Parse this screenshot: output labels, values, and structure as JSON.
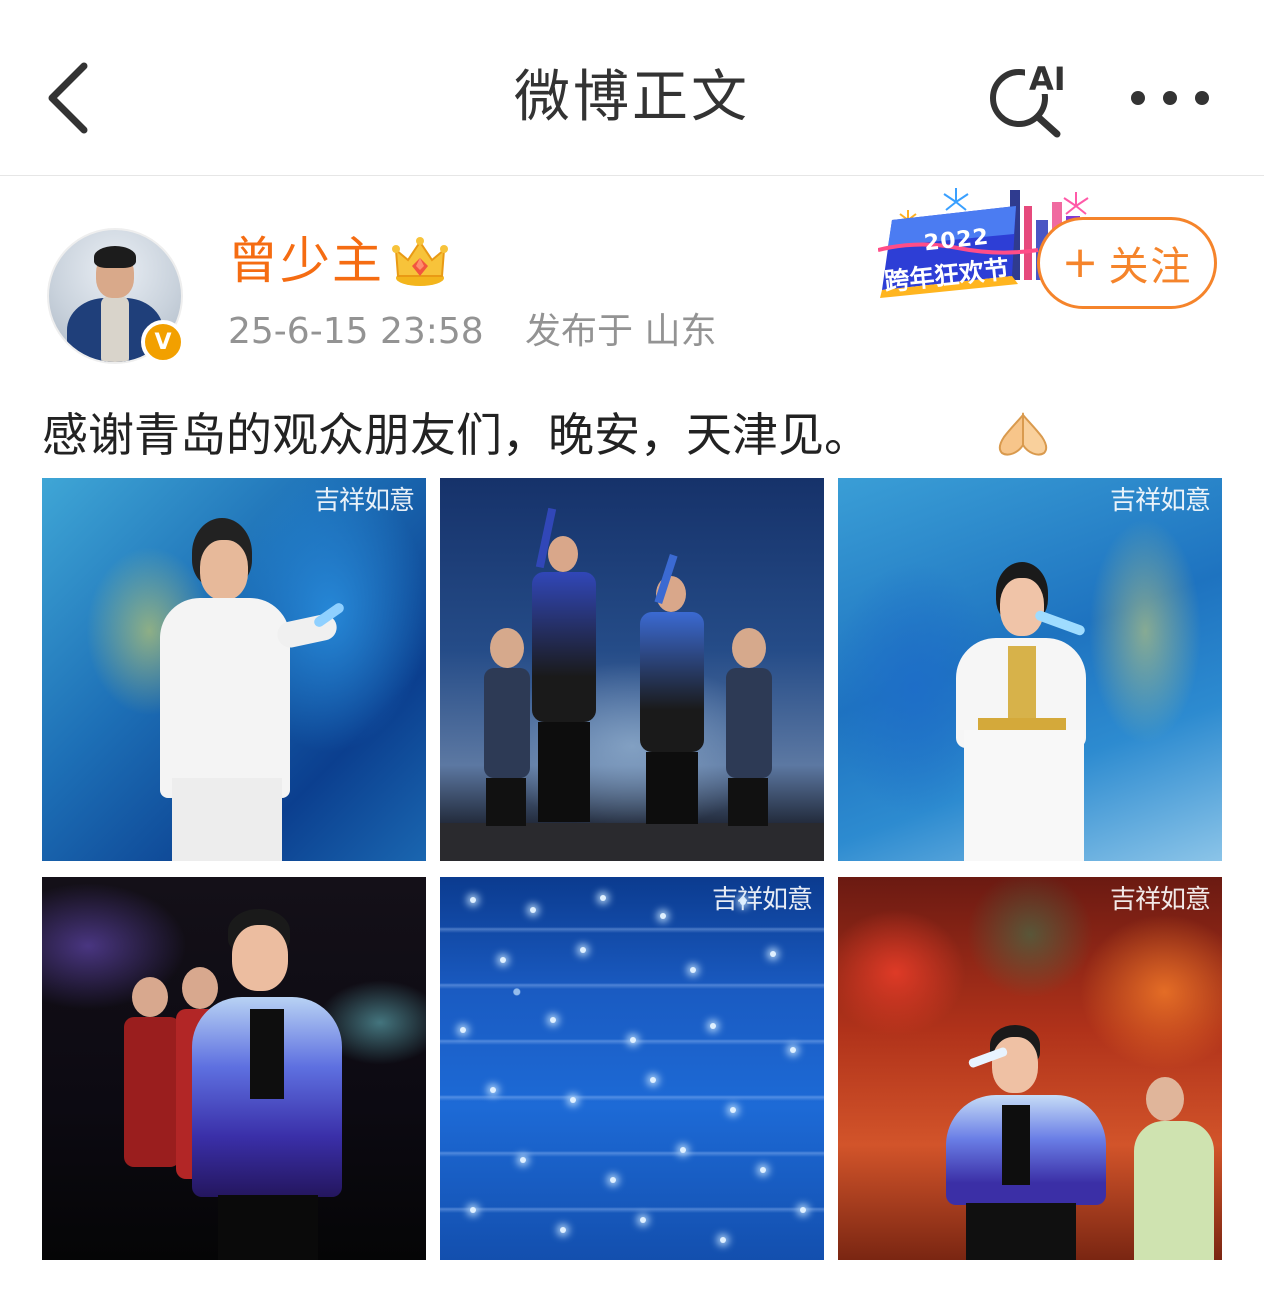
{
  "header": {
    "title": "微博正文",
    "ai_label": "AI"
  },
  "author": {
    "name": "曾少主",
    "verified_mark": "V",
    "time": "25-6-15 23:58",
    "location": "发布于 山东"
  },
  "badge": {
    "year": "2022",
    "text": "跨年狂欢节"
  },
  "follow": {
    "plus": "+",
    "label": "关注"
  },
  "post": {
    "text": "感谢青岛的观众朋友们，晚安，天津见。",
    "emoji": "pray-hands"
  },
  "photos": [
    {
      "watermark": "吉祥如意"
    },
    {
      "watermark": ""
    },
    {
      "watermark": "吉祥如意"
    },
    {
      "watermark": ""
    },
    {
      "watermark": "吉祥如意"
    },
    {
      "watermark": "吉祥如意"
    }
  ],
  "colors": {
    "name_orange": "#f56c12",
    "follow_orange": "#f5842b",
    "meta_gray": "#939393",
    "verified_gold": "#f2a000"
  }
}
